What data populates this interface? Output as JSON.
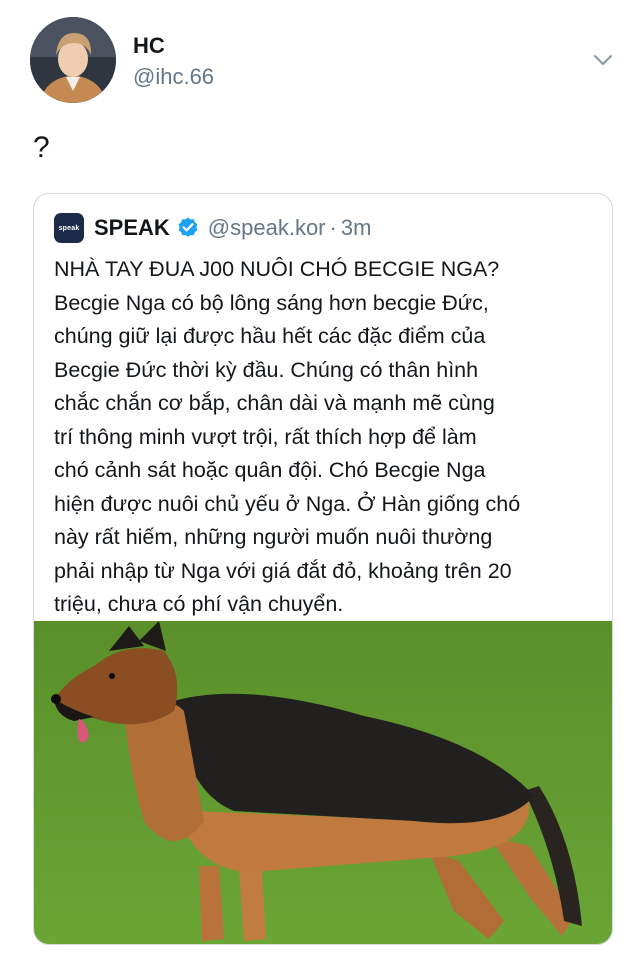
{
  "author": {
    "display_name": "HC",
    "handle": "@ihc.66",
    "avatar_icon": "avatar-portrait"
  },
  "tweet": {
    "text": "?"
  },
  "more_menu_icon": "chevron-down-icon",
  "quoted_tweet": {
    "logo_text": "speak",
    "display_name": "SPEAK",
    "verified_icon": "verified-badge-icon",
    "handle": "@speak.kor",
    "separator": "·",
    "time": "3m",
    "lines": [
      "NHÀ TAY ĐUA J00 NUÔI CHÓ BECGIE NGA?",
      "Becgie Nga có bộ lông sáng hơn becgie Đức,",
      "chúng giữ lại được hầu hết các đặc điểm của",
      "Becgie Đức thời kỳ đầu. Chúng có thân hình",
      "chắc chắn cơ bắp, chân dài và mạnh mẽ cùng",
      "trí thông minh vượt trội, rất thích hợp để làm",
      "chó cảnh sát hoặc quân đội. Chó Becgie Nga",
      "hiện được nuôi chủ yếu ở Nga. Ở Hàn giống chó",
      "này rất hiếm, những người muốn nuôi thường",
      "phải nhập từ Nga với giá đắt đỏ, khoảng trên 20",
      "triệu, chưa có phí vận chuyển."
    ],
    "image_subject": "german-shepherd-dog-photo"
  },
  "colors": {
    "secondary_text": "#657786",
    "verified_blue": "#1da1f2",
    "border": "#cfd9de",
    "grass": "#5f9a2a"
  }
}
